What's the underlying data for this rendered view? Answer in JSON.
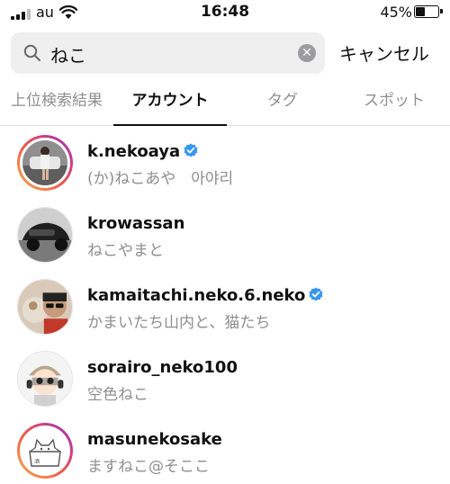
{
  "status_bar": {
    "carrier": "au",
    "time": "16:48",
    "battery_percent": "45%",
    "battery_level": 0.45
  },
  "search": {
    "value": "ねこ",
    "cancel_label": "キャンセル"
  },
  "tabs": [
    {
      "label": "上位検索結果",
      "active": false
    },
    {
      "label": "アカウント",
      "active": true
    },
    {
      "label": "タグ",
      "active": false
    },
    {
      "label": "スポット",
      "active": false
    }
  ],
  "accounts": [
    {
      "username": "k.nekoaya",
      "full_name": "(か)ねこあや　아야리",
      "verified": true,
      "story_ring": true
    },
    {
      "username": "krowassan",
      "full_name": "ねこやまと",
      "verified": false,
      "story_ring": false
    },
    {
      "username": "kamaitachi.neko.6.neko",
      "full_name": "かまいたち山内と、猫たち",
      "verified": true,
      "story_ring": false
    },
    {
      "username": "sorairo_neko100",
      "full_name": "空色ねこ",
      "verified": false,
      "story_ring": false
    },
    {
      "username": "masunekosake",
      "full_name": "ますねこ@そここ",
      "verified": false,
      "story_ring": true
    }
  ],
  "colors": {
    "verified_blue": "#3897f0",
    "secondary_text": "#8e8e8e",
    "search_bg": "#efeff0"
  }
}
